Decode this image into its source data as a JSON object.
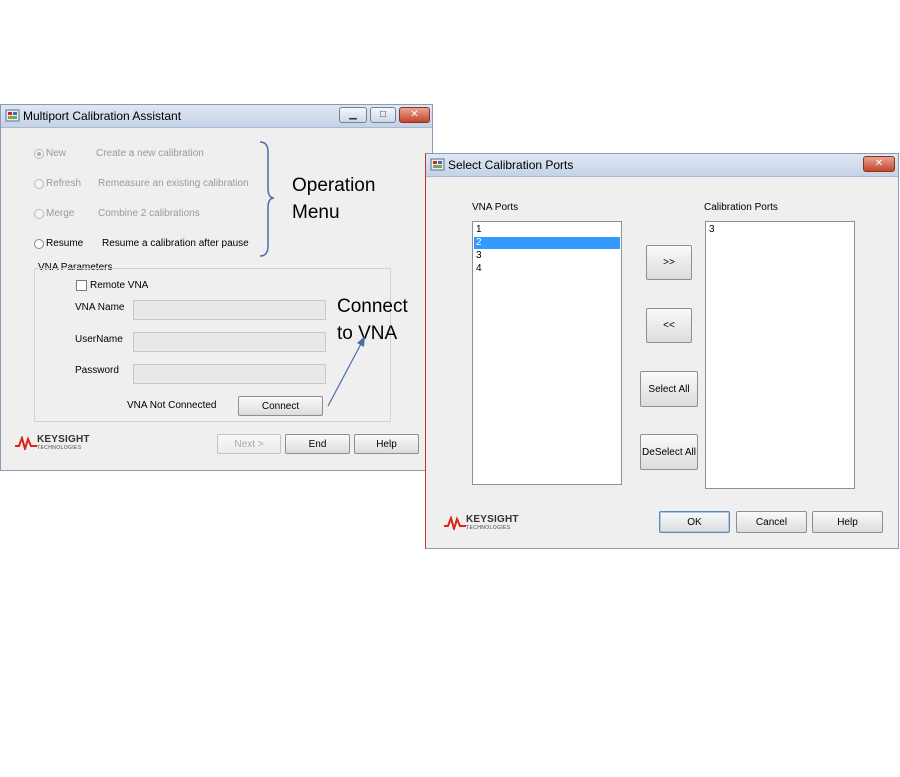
{
  "window1": {
    "title": "Multiport Calibration Assistant",
    "controls": {
      "minimize": "▁",
      "maximize": "□",
      "close": "✕"
    },
    "operation_options": [
      {
        "label": "New",
        "description": "Create a new calibration",
        "enabled": false,
        "selected": true
      },
      {
        "label": "Refresh",
        "description": "Remeasure an existing calibration",
        "enabled": false,
        "selected": false
      },
      {
        "label": "Merge",
        "description": "Combine 2 calibrations",
        "enabled": false,
        "selected": false
      },
      {
        "label": "Resume",
        "description": "Resume a calibration after pause",
        "enabled": true,
        "selected": false
      }
    ],
    "vna_parameters": {
      "group_label": "VNA Parameters",
      "remote_vna_label": "Remote VNA",
      "remote_vna_checked": false,
      "vna_name_label": "VNA Name",
      "vna_name_value": "",
      "username_label": "UserName",
      "username_value": "",
      "password_label": "Password",
      "password_value": "",
      "status_text": "VNA  Not Connected",
      "connect_label": "Connect"
    },
    "buttons": {
      "next": "Next >",
      "end": "End",
      "help": "Help"
    },
    "logo": {
      "name": "KEYSIGHT",
      "sub": "TECHNOLOGIES"
    }
  },
  "window2": {
    "title": "Select Calibration Ports",
    "controls": {
      "close": "✕"
    },
    "vna_ports_label": "VNA Ports",
    "vna_ports": [
      "1",
      "2",
      "3",
      "4"
    ],
    "vna_ports_selected": "2",
    "calibration_ports_label": "Calibration Ports",
    "calibration_ports": [
      "3"
    ],
    "buttons": {
      "add": ">>",
      "remove": "<<",
      "select_all": "Select All",
      "deselect_all": "DeSelect All",
      "ok": "OK",
      "cancel": "Cancel",
      "help": "Help"
    },
    "logo": {
      "name": "KEYSIGHT",
      "sub": "TECHNOLOGIES"
    }
  },
  "annotations": {
    "operation_menu": [
      "Operation",
      "Menu"
    ],
    "connect_to_vna": [
      "Connect",
      "to VNA"
    ]
  },
  "colors": {
    "selection": "#3399ff",
    "logo_red": "#d9261c",
    "annotation_line": "#4a6fa5"
  }
}
